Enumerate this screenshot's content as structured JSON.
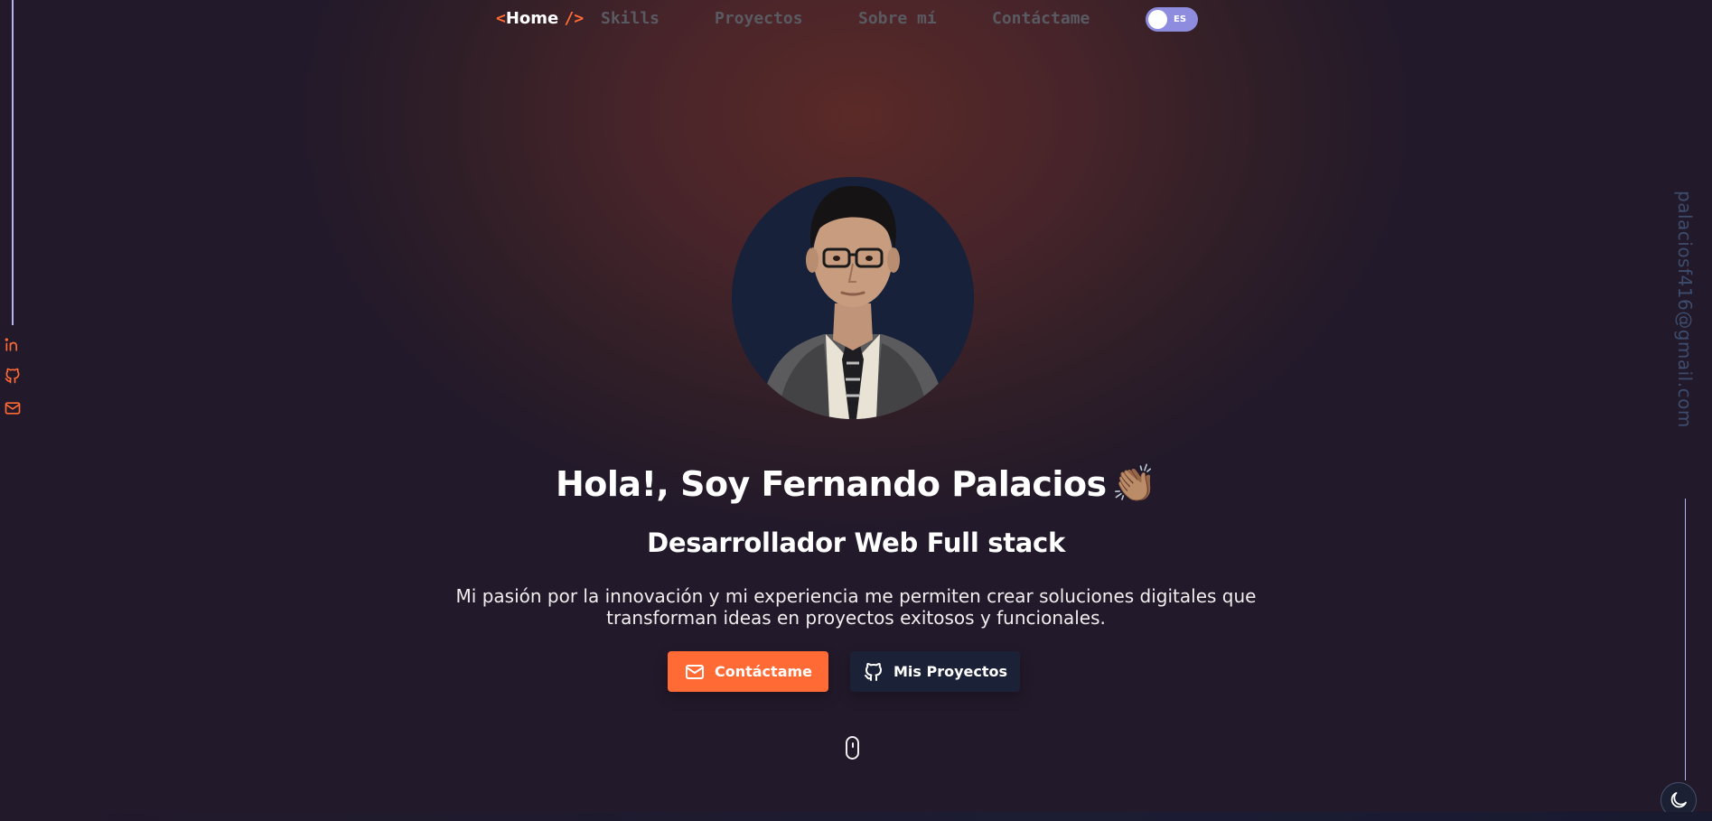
{
  "nav": {
    "home_open": "<",
    "home_label": "Home",
    "home_close": "/>",
    "items": [
      {
        "label": "Skills"
      },
      {
        "label": "Proyectos"
      },
      {
        "label": "Sobre mí"
      },
      {
        "label": "Contáctame"
      }
    ],
    "lang_toggle": {
      "label": "ES",
      "checked": false
    }
  },
  "social": {
    "icons": [
      "linkedin-icon",
      "github-icon",
      "mail-icon"
    ],
    "email_vertical": "palaciosf416@gmail.com"
  },
  "hero": {
    "title": "Hola!, Soy Fernando Palacios",
    "title_emoji": "👏🏽",
    "subtitle": "Desarrollador Web Full stack",
    "description": "Mi pasión por la innovación y mi experiencia me permiten crear soluciones digitales que transforman ideas en proyectos exitosos y funcionales.",
    "buttons": {
      "contact": {
        "label": "Contáctame",
        "icon": "mail-icon"
      },
      "projects": {
        "label": "Mis Proyectos",
        "icon": "github-icon"
      }
    }
  },
  "colors": {
    "accent": "#ff6a35",
    "toggle": "#8d8cdf",
    "rail": "#b6b2f4",
    "email_text": "#3d4c6c",
    "projects_button": "#1b2136"
  }
}
